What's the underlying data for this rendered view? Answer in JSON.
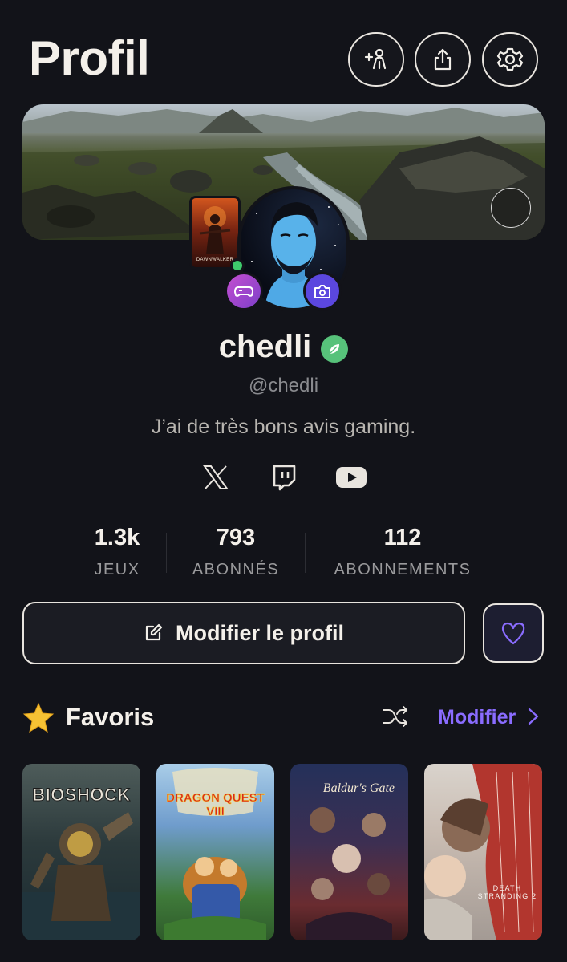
{
  "header": {
    "title": "Profil",
    "buttons": [
      "add-friend-icon",
      "share-icon",
      "settings-icon"
    ]
  },
  "profile": {
    "username": "chedli",
    "handle": "@chedli",
    "bio": "J’ai de très bons avis gaming.",
    "online": true,
    "featured_game_label": "DAWNWALKER"
  },
  "socials": [
    "x-icon",
    "twitch-icon",
    "youtube-icon"
  ],
  "stats": [
    {
      "value": "1.3k",
      "label": "JEUX"
    },
    {
      "value": "793",
      "label": "ABONNÉS"
    },
    {
      "value": "112",
      "label": "ABONNEMENTS"
    }
  ],
  "actions": {
    "edit_profile_label": "Modifier le profil"
  },
  "favorites": {
    "title": "Favoris",
    "modify_label": "Modifier",
    "games": [
      {
        "title": "BIOSHOCK"
      },
      {
        "title": "DRAGON QUEST VIII"
      },
      {
        "title": "Baldur's Gate"
      },
      {
        "title": "DEATH STRANDING 2"
      }
    ]
  },
  "colors": {
    "background": "#121319",
    "accent": "#8a6cff",
    "online": "#3ecb6c",
    "verified": "#57c27a"
  }
}
